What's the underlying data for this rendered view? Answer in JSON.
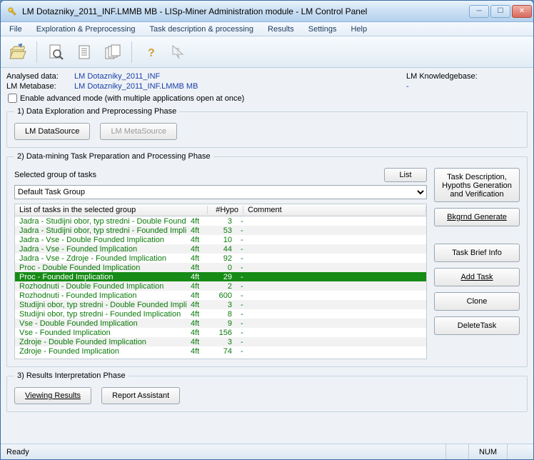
{
  "window": {
    "title": "LM Dotazniky_2011_INF.LMMB MB - LISp-Miner Administration module - LM Control Panel"
  },
  "menu": {
    "file": "File",
    "exploration": "Exploration & Preprocessing",
    "task": "Task description & processing",
    "results": "Results",
    "settings": "Settings",
    "help": "Help"
  },
  "info": {
    "analysed_label": "Analysed data:",
    "analysed_value": "LM Dotazniky_2011_INF",
    "metabase_label": "LM Metabase:",
    "metabase_value": "LM Dotazniky_2011_INF.LMMB MB",
    "kb_label": "LM Knowledgebase:",
    "kb_value": "-"
  },
  "advanced": {
    "label": "Enable advanced mode (with multiple applications open at once)"
  },
  "phase1": {
    "legend": "1) Data Exploration and Preprocessing Phase",
    "btn_datasource": "LM DataSource",
    "btn_metasource": "LM MetaSource"
  },
  "phase2": {
    "legend": "2) Data-mining Task Preparation and Processing  Phase",
    "sel_label": "Selected group of tasks",
    "list_btn": "List",
    "combo_value": "Default Task Group",
    "list_label": "List of tasks in the selected group",
    "col_hypo": "#Hypo",
    "col_comment": "Comment",
    "tasks": [
      {
        "name": "Jadra - Studijni obor, typ stredni - Double Founde",
        "type": "4ft",
        "hypo": "3",
        "comment": "-",
        "sel": false
      },
      {
        "name": "Jadra - Studijni obor, typ stredni - Founded Implic",
        "type": "4ft",
        "hypo": "53",
        "comment": "-",
        "sel": false
      },
      {
        "name": "Jadra - Vse - Double Founded Implication",
        "type": "4ft",
        "hypo": "10",
        "comment": "-",
        "sel": false
      },
      {
        "name": "Jadra - Vse - Founded Implication",
        "type": "4ft",
        "hypo": "44",
        "comment": "-",
        "sel": false
      },
      {
        "name": "Jadra - Vse - Zdroje - Founded Implication",
        "type": "4ft",
        "hypo": "92",
        "comment": "-",
        "sel": false
      },
      {
        "name": "Proc - Double Founded Implication",
        "type": "4ft",
        "hypo": "0",
        "comment": "-",
        "sel": false
      },
      {
        "name": "Proc - Founded Implication",
        "type": "4ft",
        "hypo": "29",
        "comment": "-",
        "sel": true
      },
      {
        "name": "Rozhodnuti - Double Founded Implication",
        "type": "4ft",
        "hypo": "2",
        "comment": "-",
        "sel": false
      },
      {
        "name": "Rozhodnuti - Founded Implication",
        "type": "4ft",
        "hypo": "600",
        "comment": "-",
        "sel": false
      },
      {
        "name": "Studijni obor, typ stredni - Double Founded Implic",
        "type": "4ft",
        "hypo": "3",
        "comment": "-",
        "sel": false
      },
      {
        "name": "Studijni obor, typ stredni - Founded Implication",
        "type": "4ft",
        "hypo": "8",
        "comment": "-",
        "sel": false
      },
      {
        "name": "Vse - Double Founded Implication",
        "type": "4ft",
        "hypo": "9",
        "comment": "-",
        "sel": false
      },
      {
        "name": "Vse - Founded Implication",
        "type": "4ft",
        "hypo": "156",
        "comment": "-",
        "sel": false
      },
      {
        "name": "Zdroje - Double Founded Implication",
        "type": "4ft",
        "hypo": "3",
        "comment": "-",
        "sel": false
      },
      {
        "name": "Zdroje - Founded Implication",
        "type": "4ft",
        "hypo": "74",
        "comment": "-",
        "sel": false
      }
    ],
    "btn_task_desc": "Task Description, Hypoths Generation and Verification",
    "btn_bkgrnd": "Bkgrnd Generate",
    "btn_brief": "Task Brief Info",
    "btn_add": "Add Task",
    "btn_clone": "Clone",
    "btn_delete": "DeleteTask"
  },
  "phase3": {
    "legend": "3) Results Interpretation Phase",
    "btn_view": "Viewing Results",
    "btn_report": "Report Assistant"
  },
  "status": {
    "ready": "Ready",
    "num": "NUM"
  }
}
